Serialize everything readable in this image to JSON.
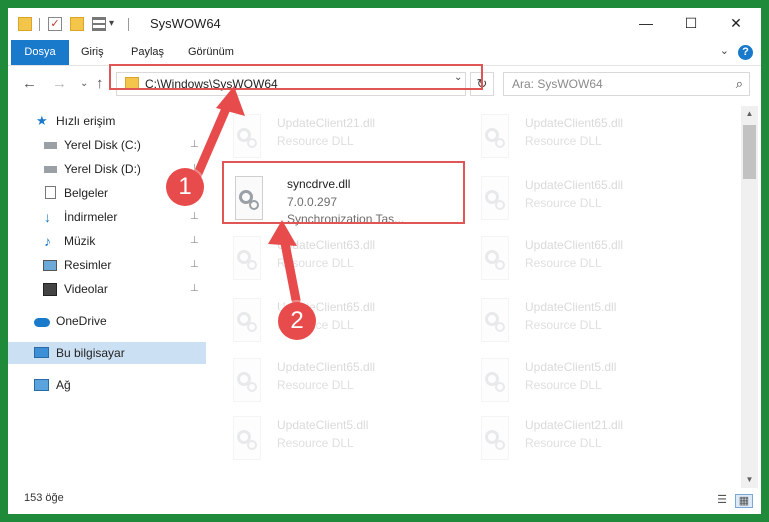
{
  "window": {
    "title": "SysWOW64",
    "controls": {
      "minimize": "—",
      "maximize": "☐",
      "close": "✕"
    }
  },
  "ribbon": {
    "tabs": [
      "Dosya",
      "Giriş",
      "Paylaş",
      "Görünüm"
    ],
    "help": "?",
    "collapse": "⌄"
  },
  "navigation": {
    "back": "←",
    "forward": "→",
    "recent": "⌄",
    "up": "↑",
    "address": "C:\\Windows\\SysWOW64",
    "address_dropdown": "⌄",
    "refresh": "↻",
    "search_placeholder": "Ara: SysWOW64",
    "search_icon": "⌕"
  },
  "sidebar": {
    "items": [
      {
        "label": "Hızlı erişim",
        "icon": "star-icon"
      },
      {
        "label": "Yerel Disk (C:)",
        "icon": "drive-icon",
        "pinned": true
      },
      {
        "label": "Yerel Disk (D:)",
        "icon": "drive-icon",
        "pinned": true
      },
      {
        "label": "Belgeler",
        "icon": "documents-icon",
        "pinned": true
      },
      {
        "label": "İndirmeler",
        "icon": "download-icon",
        "pinned": true
      },
      {
        "label": "Müzik",
        "icon": "music-icon",
        "pinned": true
      },
      {
        "label": "Resimler",
        "icon": "pictures-icon",
        "pinned": true
      },
      {
        "label": "Videolar",
        "icon": "videos-icon",
        "pinned": true
      },
      {
        "label": "OneDrive",
        "icon": "cloud-icon"
      },
      {
        "label": "Bu bilgisayar",
        "icon": "computer-icon",
        "selected": true
      },
      {
        "label": "Ağ",
        "icon": "network-icon"
      }
    ],
    "pin_glyph": "⊥"
  },
  "files": {
    "highlighted": {
      "name": "syncdrve.dll",
      "version": "7.0.0.297",
      "description": "Synchronization Tas..."
    },
    "faded_type": "Resource DLL",
    "left_column": [
      "UpdateClient21.dll",
      "UpdateClient63.dll",
      "UpdateClient65.dll",
      "UpdateClient65.dll",
      "UpdateClient5.dll"
    ],
    "right_column": [
      "UpdateClient65.dll",
      "UpdateClient65.dll",
      "UpdateClient65.dll",
      "UpdateClient5.dll",
      "UpdateClient5.dll",
      "UpdateClient21.dll"
    ]
  },
  "status": {
    "count": "153 öğe"
  },
  "annotations": {
    "step1": "1",
    "step2": "2"
  },
  "colors": {
    "accent": "#1979ca",
    "highlight": "#e05555",
    "badge": "#e84b4b",
    "desktop": "#1e8a3a"
  }
}
